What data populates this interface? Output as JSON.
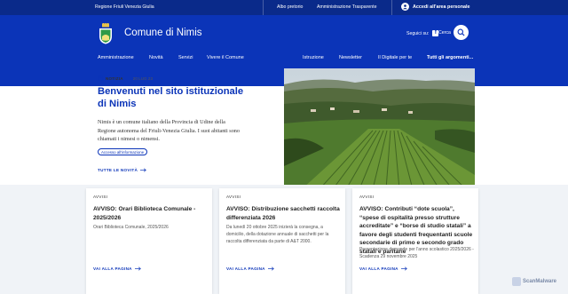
{
  "topbar": {
    "region": "Regione Friuli Venezia Giulia",
    "links": [
      "Albo pretorio",
      "Amministrazione Trasparente"
    ],
    "login": "Accedi all'area personale"
  },
  "header": {
    "title": "Comune di Nimis",
    "social_label": "Seguici su:",
    "search_label": "Cerca",
    "nav_left": [
      "Amministrazione",
      "Novità",
      "Servizi",
      "Vivere il Comune"
    ],
    "nav_right": [
      "Istruzione",
      "Newsletter",
      "Il Digitale per te",
      "Tutti gli argomenti..."
    ]
  },
  "hero": {
    "category": "NOTIZIA",
    "date": "20 LUG 23",
    "title": "Benvenuti nel sito istituzionale di Nimis",
    "text": "Nimis è un comune italiano della Provincia di Udine della Regione autonoma del Friuli-Venezia Giulia. I suoi abitanti sono chiamati i nimesi o nimensi.",
    "chip": "Accesso all'informazione",
    "all_news": "TUTTE LE NOVITÀ"
  },
  "cards": [
    {
      "category": "AVVISI",
      "title": "AVVISO: Orari Biblioteca Comunale - 2025/2026",
      "desc": "Orari Biblioteca Comunale, 2025/2026",
      "link": "VAI ALLA PAGINA"
    },
    {
      "category": "AVVISI",
      "title": "AVVISO: Distribuzione sacchetti raccolta differenziata 2026",
      "desc": "Da lunedì 20 ottobre 2025 inizierà la consegna, a domicilio, della dotazione annuale di sacchetti per la raccolta differenziata da parte di A&T 2000.",
      "link": "VAI ALLA PAGINA"
    },
    {
      "category": "AVVISI",
      "title": "AVVISO: Contributi “dote scuola”, “spese di ospitalità presso strutture accreditate” e “borse di studio statali” a favore degli studenti frequentanti scuole secondarie di primo e secondo grado statali e paritarie",
      "desc": "Presentazione domande per l'anno scolastico 2025/2026 - Scadenza 29 novembre 2025",
      "link": "VAI ALLA PAGINA"
    }
  ],
  "watermark": "ScanMalware",
  "colors": {
    "brand": "#0b34b8",
    "topbar": "#0a2a8a",
    "band": "#f0f3f7"
  }
}
